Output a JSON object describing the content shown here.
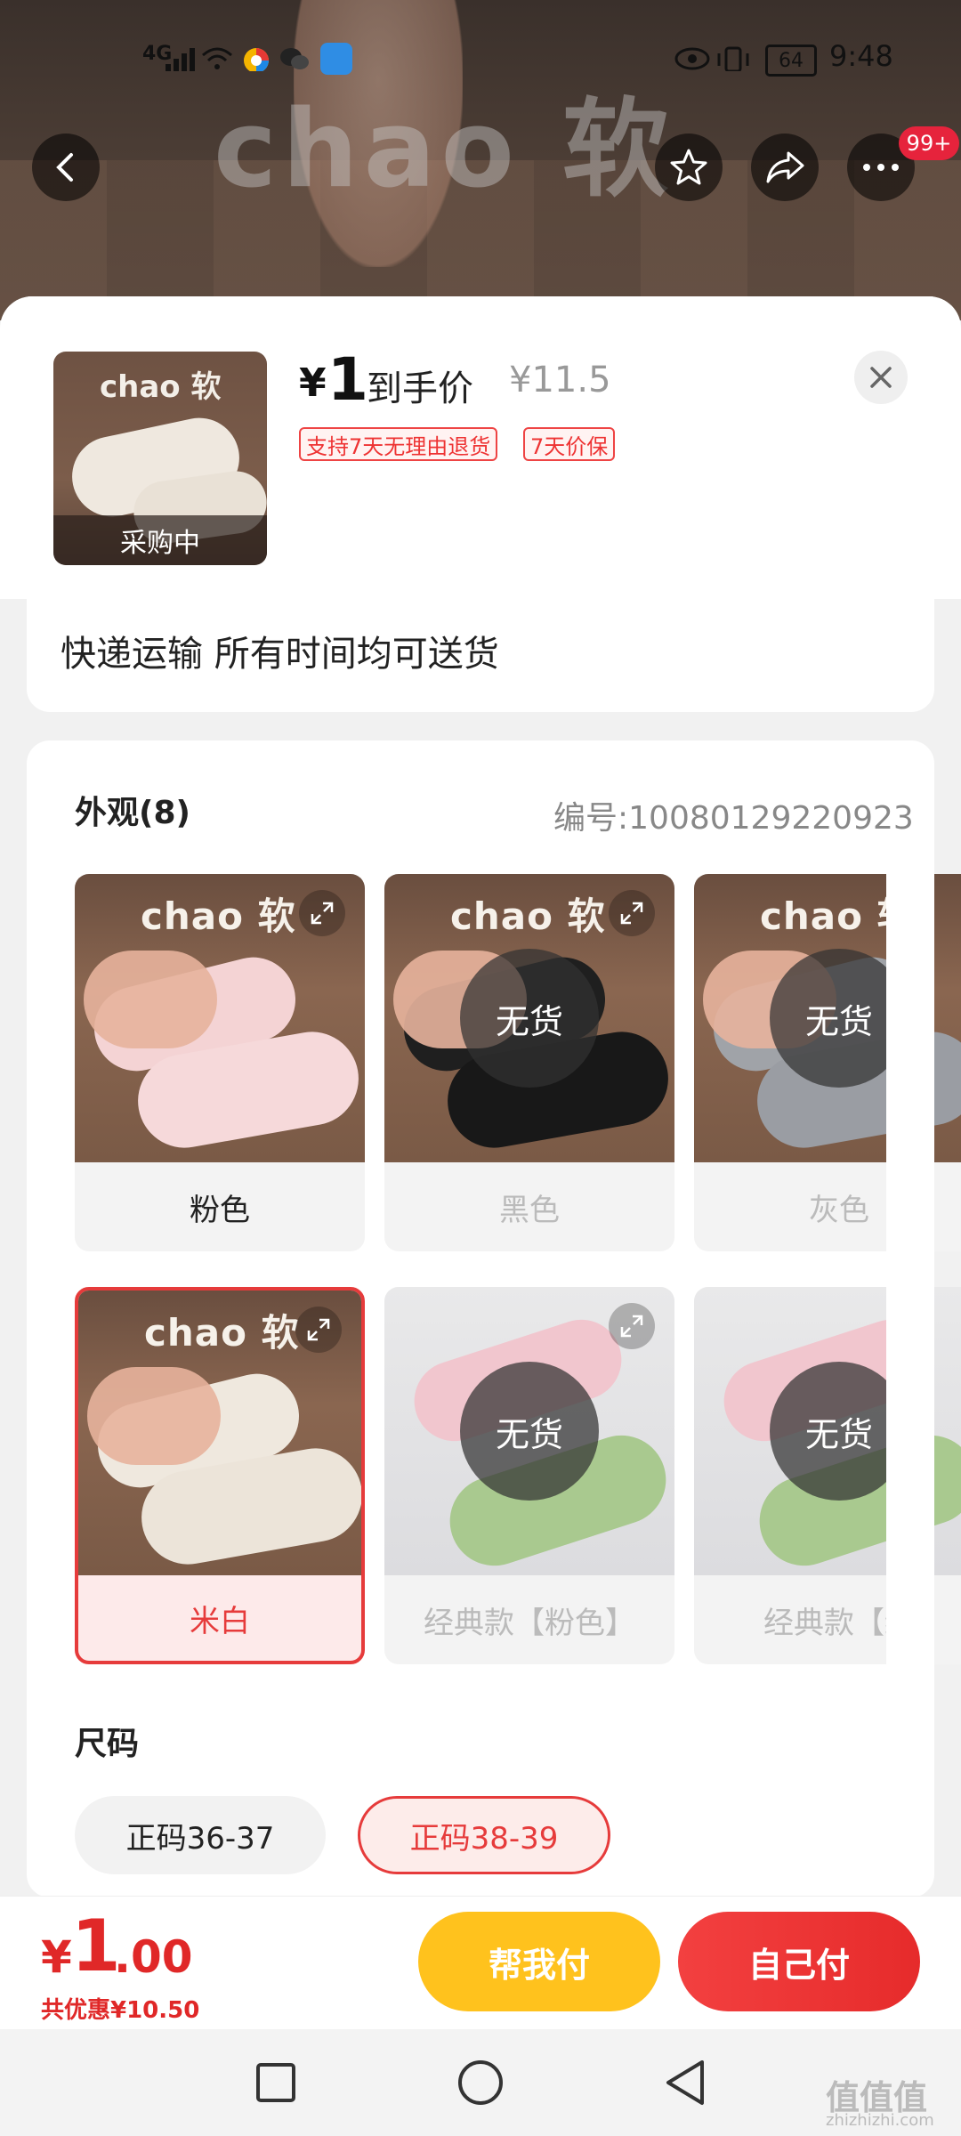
{
  "status_bar": {
    "network": "4G",
    "battery": "64",
    "time": "9:48"
  },
  "hero": {
    "brand_watermark": "chao 软",
    "notification_badge": "99+"
  },
  "summary": {
    "thumb_brand": "chao 软",
    "thumb_status": "采购中",
    "price_currency": "¥",
    "price_value": "1",
    "price_label": "到手价",
    "original_price": "¥11.5",
    "tags": [
      "支持7天无理由退货",
      "7天价保"
    ]
  },
  "shipping": {
    "text": "快递运输 所有时间均可送货"
  },
  "appearance": {
    "title": "外观(8)",
    "code": "编号:10080129220923",
    "variants": [
      {
        "brand": "chao 软",
        "label": "粉色",
        "soldout_text": "",
        "color": "#f2cfcf"
      },
      {
        "brand": "chao 软",
        "label": "黑色",
        "soldout_text": "无货",
        "color": "#1e1e1e"
      },
      {
        "brand": "chao 软",
        "label": "灰色",
        "soldout_text": "无货",
        "color": "#9a9da3"
      },
      {
        "brand": "chao 软",
        "label": "米白",
        "soldout_text": "",
        "color": "#efe8de"
      },
      {
        "brand": "",
        "label": "经典款【粉色】",
        "soldout_text": "无货",
        "color": "#f1c6ce"
      },
      {
        "brand": "",
        "label": "经典款【绿",
        "soldout_text": "无货",
        "color": "#a9c98f"
      }
    ]
  },
  "size": {
    "title": "尺码",
    "options": [
      "正码36-37",
      "正码38-39"
    ],
    "selected": "正码38-39"
  },
  "bottom": {
    "currency": "¥",
    "amount_int": "1",
    "amount_dec": ".00",
    "saving": "共优惠¥10.50",
    "help_pay_label": "帮我付",
    "self_pay_label": "自己付"
  },
  "watermark": {
    "main": "值值值",
    "sub": "zhizhizhi.com"
  }
}
